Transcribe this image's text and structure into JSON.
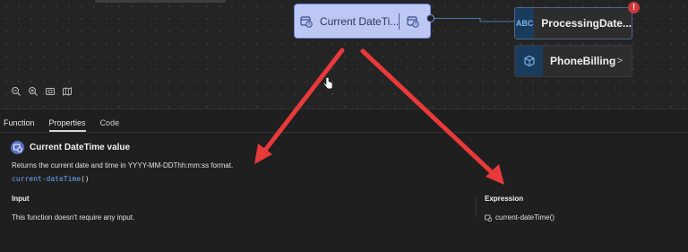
{
  "canvas": {
    "selected_node": {
      "title": "Current DateTi...",
      "icon": "calendar-clock-icon"
    },
    "nodes": [
      {
        "badge": "ABC",
        "label": "ProcessingDate...",
        "has_error": true,
        "error_glyph": "!"
      },
      {
        "badge_icon": "cube-icon",
        "label": "PhoneBilling",
        "chevron": ">"
      }
    ],
    "zoom_controls": [
      "zoom-out-icon",
      "zoom-in-icon",
      "fit-view-icon",
      "map-icon"
    ]
  },
  "panel": {
    "tabs": [
      {
        "label": "Function",
        "active": false
      },
      {
        "label": "Properties",
        "active": true
      },
      {
        "label": "Code",
        "active": false
      }
    ],
    "function_title": "Current DateTime value",
    "description": "Returns the current date and time in YYYY-MM-DDThh:mm:ss format.",
    "code": {
      "name": "current-dateTime",
      "parens": "()"
    },
    "input": {
      "title": "Input",
      "text": "This function doesn't require any input."
    },
    "expression": {
      "title": "Expression",
      "value": "current-dateTime()"
    }
  },
  "colors": {
    "arrow": "#e8393b",
    "selected_node_bg": "#bcc8f3",
    "accent_blue": "#6aa8ff",
    "error": "#d13438"
  }
}
